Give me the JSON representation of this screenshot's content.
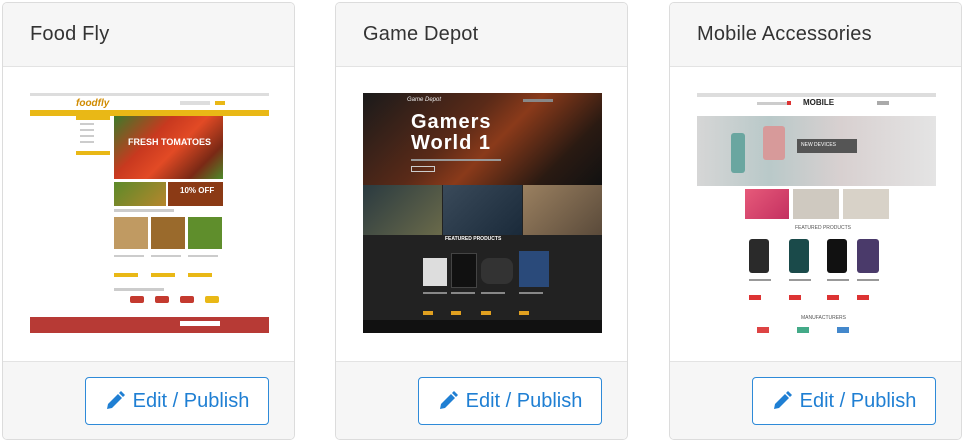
{
  "cards": [
    {
      "title": "Food Fly",
      "button_label": "Edit / Publish",
      "preview": {
        "logo": "foodfly",
        "hero": "FRESH TOMATOES",
        "promo": "10% OFF"
      }
    },
    {
      "title": "Game Depot",
      "button_label": "Edit / Publish",
      "preview": {
        "logo": "Game Depot",
        "hero_line1": "Gamers",
        "hero_line2": "World 1",
        "section": "FEATURED PRODUCTS"
      }
    },
    {
      "title": "Mobile Accessories",
      "button_label": "Edit / Publish",
      "preview": {
        "logo": "MOBILE",
        "banner": "NEW DEVICES",
        "section": "FEATURED PRODUCTS",
        "footer_section": "MANUFACTURERS"
      }
    }
  ],
  "icons": {
    "edit": "pencil-icon"
  },
  "colors": {
    "accent": "#2e8ad8",
    "header_bg": "#f6f6f6",
    "food_yellow": "#e9b816",
    "food_red": "#b73a35"
  }
}
